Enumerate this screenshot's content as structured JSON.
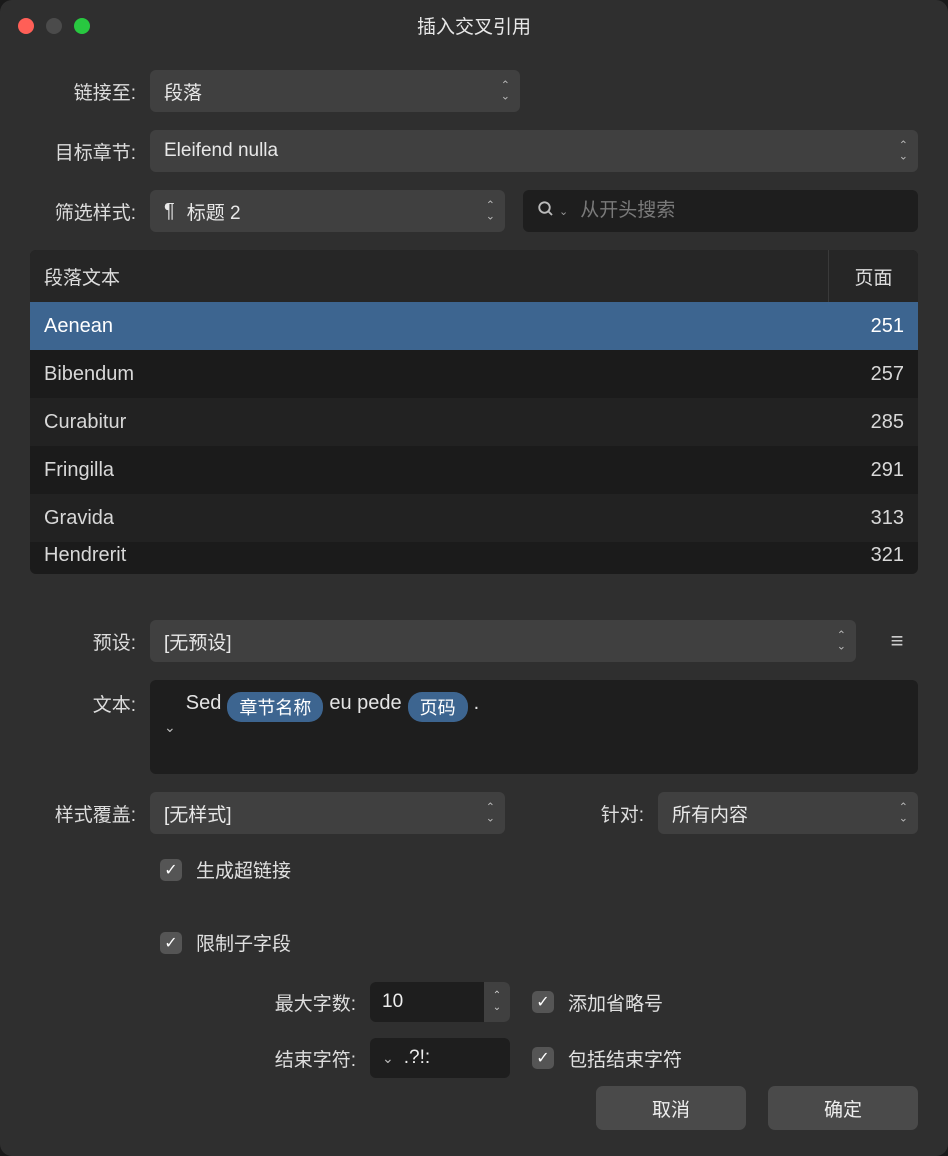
{
  "window": {
    "title": "插入交叉引用"
  },
  "labels": {
    "link_to": "链接至:",
    "target_chapter": "目标章节:",
    "filter_style": "筛选样式:",
    "preset": "预设:",
    "text": "文本:",
    "style_override": "样式覆盖:",
    "for": "针对:",
    "max_chars": "最大字数:",
    "end_chars": "结束字符:"
  },
  "selects": {
    "link_to": "段落",
    "target_chapter": "Eleifend nulla",
    "filter_style": "标题 2",
    "preset": "[无预设]",
    "style_override": "[无样式]",
    "for": "所有内容"
  },
  "search": {
    "placeholder": "从开头搜索"
  },
  "table": {
    "headers": {
      "text": "段落文本",
      "page": "页面"
    },
    "rows": [
      {
        "text": "Aenean",
        "page": "251",
        "selected": true
      },
      {
        "text": "Bibendum",
        "page": "257"
      },
      {
        "text": "Curabitur",
        "page": "285"
      },
      {
        "text": "Fringilla",
        "page": "291"
      },
      {
        "text": "Gravida",
        "page": "313"
      },
      {
        "text": "Hendrerit",
        "page": "321",
        "partial": true
      }
    ]
  },
  "text_tokens": {
    "t0": "Sed",
    "pill0": "章节名称",
    "t1": "eu pede",
    "pill1": "页码",
    "t2": "."
  },
  "checkboxes": {
    "hyperlink": "生成超链接",
    "limit_sub": "限制子字段",
    "ellipsis": "添加省略号",
    "include_end": "包括结束字符"
  },
  "values": {
    "max_chars": "10",
    "end_chars": ".?!:"
  },
  "buttons": {
    "cancel": "取消",
    "ok": "确定"
  },
  "icons": {
    "pilcrow": "¶",
    "check": "✓",
    "hamburger": "≡"
  }
}
